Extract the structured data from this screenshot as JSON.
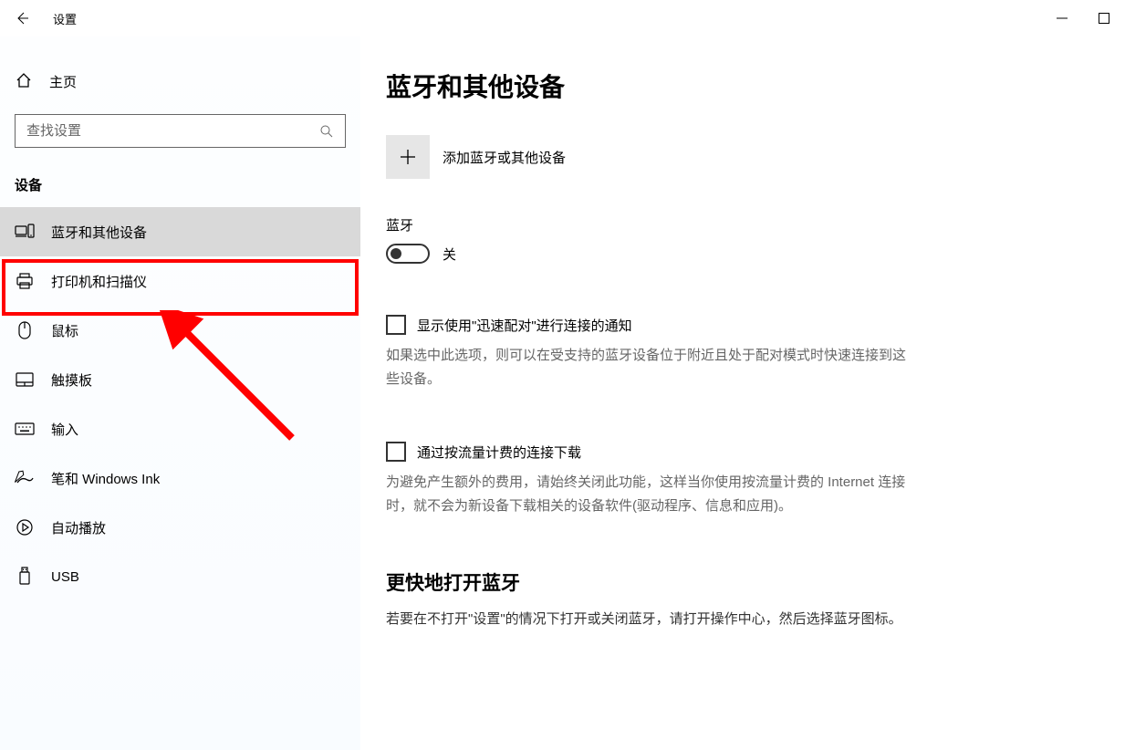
{
  "window": {
    "title": "设置"
  },
  "sidebar": {
    "home_label": "主页",
    "search_placeholder": "查找设置",
    "section_title": "设备",
    "items": [
      {
        "icon": "devices",
        "label": "蓝牙和其他设备",
        "selected": true
      },
      {
        "icon": "printer",
        "label": "打印机和扫描仪",
        "selected": false
      },
      {
        "icon": "mouse",
        "label": "鼠标",
        "selected": false
      },
      {
        "icon": "touchpad",
        "label": "触摸板",
        "selected": false
      },
      {
        "icon": "keyboard",
        "label": "输入",
        "selected": false
      },
      {
        "icon": "pen",
        "label": "笔和 Windows Ink",
        "selected": false
      },
      {
        "icon": "autoplay",
        "label": "自动播放",
        "selected": false
      },
      {
        "icon": "usb",
        "label": "USB",
        "selected": false
      }
    ]
  },
  "main": {
    "page_title": "蓝牙和其他设备",
    "add_device_label": "添加蓝牙或其他设备",
    "bluetooth_heading": "蓝牙",
    "toggle_state": "关",
    "quickpair": {
      "label": "显示使用\"迅速配对\"进行连接的通知",
      "desc": "如果选中此选项，则可以在受支持的蓝牙设备位于附近且处于配对模式时快速连接到这些设备。"
    },
    "metered": {
      "label": "通过按流量计费的连接下载",
      "desc": "为避免产生额外的费用，请始终关闭此功能，这样当你使用按流量计费的 Internet 连接时，就不会为新设备下载相关的设备软件(驱动程序、信息和应用)。"
    },
    "faster_section_title": "更快地打开蓝牙",
    "faster_body": "若要在不打开\"设置\"的情况下打开或关闭蓝牙，请打开操作中心，然后选择蓝牙图标。"
  }
}
